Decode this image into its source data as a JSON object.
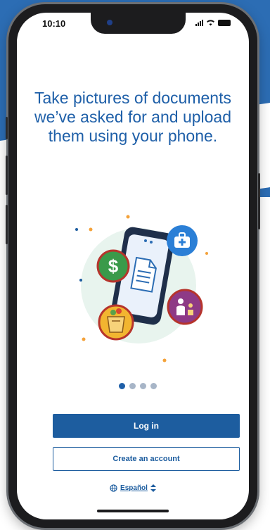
{
  "status_bar": {
    "time": "10:10"
  },
  "onboarding": {
    "headline": "Take pictures of documents we’ve asked for and upload them using your phone.",
    "carousel": {
      "total_pages": 4,
      "current_page": 1
    }
  },
  "actions": {
    "login_label": "Log in",
    "create_account_label": "Create an account"
  },
  "language": {
    "label": "Español",
    "icon": "globe-icon",
    "chevron": "sort-chevron-icon"
  },
  "illustration_icons": [
    "dollar-icon",
    "medical-briefcase-icon",
    "document-icon",
    "grocery-bag-icon",
    "family-icon"
  ],
  "colors": {
    "brand_blue": "#1d5d9f",
    "headline_blue": "#1e5fa8",
    "background_blue": "#2c6db4"
  }
}
